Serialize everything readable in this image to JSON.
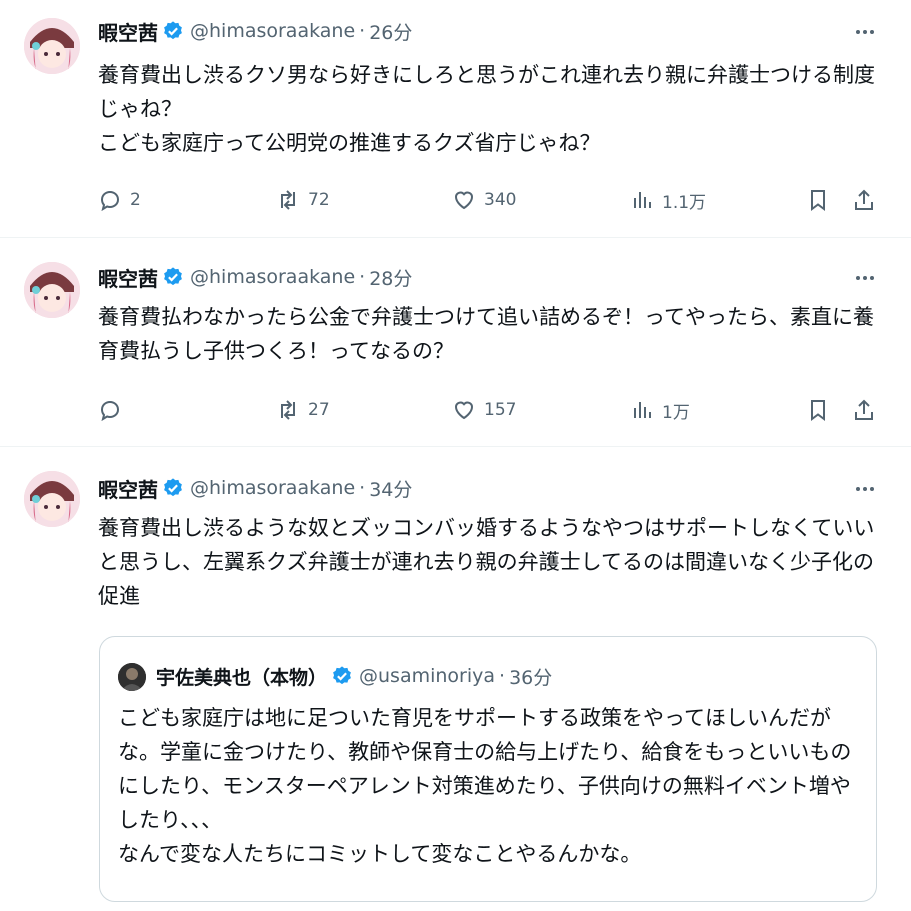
{
  "tweets": [
    {
      "name": "暇空茜",
      "handle": "@himasoraakane",
      "time": "26分",
      "text": "養育費出し渋るクソ男なら好きにしろと思うがこれ連れ去り親に弁護士つける制度じゃね？\nこども家庭庁って公明党の推進するクズ省庁じゃね？",
      "replies": "2",
      "retweets": "72",
      "likes": "340",
      "views": "1.1万"
    },
    {
      "name": "暇空茜",
      "handle": "@himasoraakane",
      "time": "28分",
      "text": "養育費払わなかったら公金で弁護士つけて追い詰めるぞ！ってやったら、素直に養育費払うし子供つくろ！ってなるの？",
      "replies": "",
      "retweets": "27",
      "likes": "157",
      "views": "1万"
    },
    {
      "name": "暇空茜",
      "handle": "@himasoraakane",
      "time": "34分",
      "text": "養育費出し渋るような奴とズッコンバッ婚するようなやつはサポートしなくていいと思うし、左翼系クズ弁護士が連れ去り親の弁護士してるのは間違いなく少子化の促進"
    }
  ],
  "quote": {
    "name": "宇佐美典也（本物）",
    "handle": "@usaminoriya",
    "time": "36分",
    "text": "こども家庭庁は地に足ついた育児をサポートする政策をやってほしいんだがな。学童に金つけたり、教師や保育士の給与上げたり、給食をもっといいものにしたり、モンスターペアレント対策進めたり、子供向けの無料イベント増やしたり、、、\nなんで変な人たちにコミットして変なことやるんかな。"
  },
  "sep": "·",
  "colors": {
    "verified": "#1d9bf0",
    "muted": "#536471",
    "border": "#cfd9de"
  },
  "icons": [
    "avatar",
    "verified-badge-icon",
    "more-icon",
    "reply-icon",
    "retweet-icon",
    "like-icon",
    "views-icon",
    "bookmark-icon",
    "share-icon"
  ]
}
